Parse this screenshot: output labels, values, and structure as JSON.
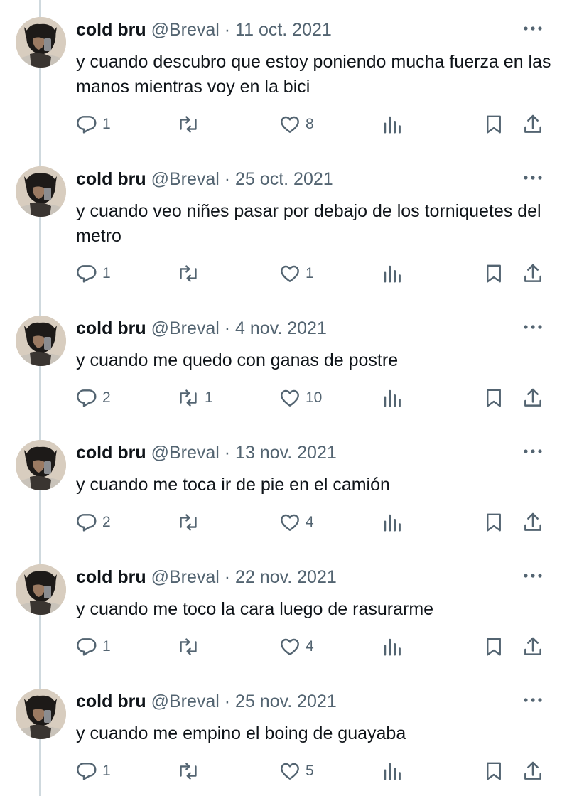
{
  "thread": {
    "tweets": [
      {
        "name": "cold bru",
        "handle": "@Breval",
        "sep": "·",
        "date": "11 oct. 2021",
        "text": "y cuando descubro que estoy poniendo mucha fuerza en las manos mientras voy en la bici",
        "replies": "1",
        "retweets": "",
        "likes": "8"
      },
      {
        "name": "cold bru",
        "handle": "@Breval",
        "sep": "·",
        "date": "25 oct. 2021",
        "text": "y cuando veo niñes pasar por debajo de los torniquetes del metro",
        "replies": "1",
        "retweets": "",
        "likes": "1"
      },
      {
        "name": "cold bru",
        "handle": "@Breval",
        "sep": "·",
        "date": "4 nov. 2021",
        "text": "y cuando me quedo con ganas de postre",
        "replies": "2",
        "retweets": "1",
        "likes": "10"
      },
      {
        "name": "cold bru",
        "handle": "@Breval",
        "sep": "·",
        "date": "13 nov. 2021",
        "text": "y cuando me toca ir de pie en el camión",
        "replies": "2",
        "retweets": "",
        "likes": "4"
      },
      {
        "name": "cold bru",
        "handle": "@Breval",
        "sep": "·",
        "date": "22 nov. 2021",
        "text": "y cuando me toco la cara luego de rasurarme",
        "replies": "1",
        "retweets": "",
        "likes": "4"
      },
      {
        "name": "cold bru",
        "handle": "@Breval",
        "sep": "·",
        "date": "25 nov. 2021",
        "text": "y cuando me empino el boing de guayaba",
        "replies": "1",
        "retweets": "",
        "likes": "5"
      }
    ]
  },
  "icons": {
    "reply": "reply-icon",
    "retweet": "retweet-icon",
    "like": "heart-icon",
    "views": "views-icon",
    "bookmark": "bookmark-icon",
    "share": "share-icon",
    "more": "more-icon"
  },
  "colors": {
    "text": "#0f1419",
    "muted": "#536471",
    "thread_line": "#cfd9de"
  }
}
